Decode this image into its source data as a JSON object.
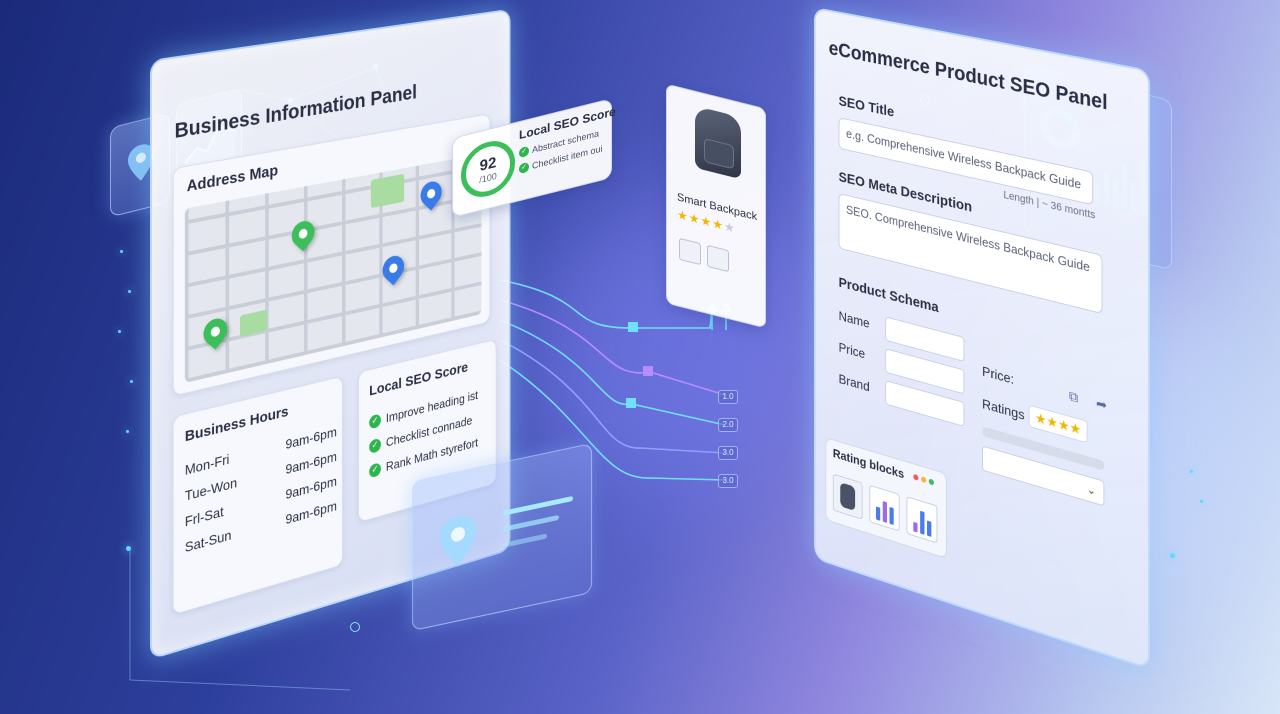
{
  "business_panel": {
    "title": "Business Information Panel",
    "map_title": "Address Map",
    "hours": {
      "title": "Business Hours",
      "rows": [
        {
          "day": "Mon-Fri",
          "time": "9am-6pm"
        },
        {
          "day": "Tue-Won",
          "time": "9am-6pm"
        },
        {
          "day": "Frl-Sat",
          "time": "9am-6pm"
        },
        {
          "day": "Sat-Sun",
          "time": "9am-6pm"
        }
      ]
    },
    "seo_card": {
      "title": "Local SEO Score",
      "items": [
        "Improve heading ist",
        "Checklist connade",
        "Rank Math styrefort"
      ]
    }
  },
  "score_badge": {
    "score": "92",
    "denominator": "/100",
    "title": "Local SEO Score",
    "items": [
      "Abstract schema",
      "Checklist item oui"
    ]
  },
  "product_card": {
    "name": "Smart Backpack",
    "rating": 4
  },
  "product_panel": {
    "title": "eCommerce Product SEO Panel",
    "seo_title_label": "SEO Title",
    "seo_title_value": "e.g. Comprehensive Wireless Backpack Guide",
    "length_note": "Length  | ~ 36 montts",
    "meta_label": "SEO Meta Description",
    "meta_value": "SEO. Comprehensive Wireless Backpack Guide",
    "schema_title": "Product Schema",
    "schema_fields": [
      "Name",
      "Price",
      "Brand"
    ],
    "price_label": "Price:",
    "ratings_label": "Ratings",
    "ratings_value": 4,
    "rating_blocks_label": "Rating blocks"
  },
  "connector_tags": [
    "1.0",
    "2.0",
    "3.0",
    "3.0"
  ],
  "colors": {
    "accent": "#5fd8ff",
    "green": "#3cbf5a",
    "blue": "#3a7bea",
    "star": "#f2b600"
  }
}
